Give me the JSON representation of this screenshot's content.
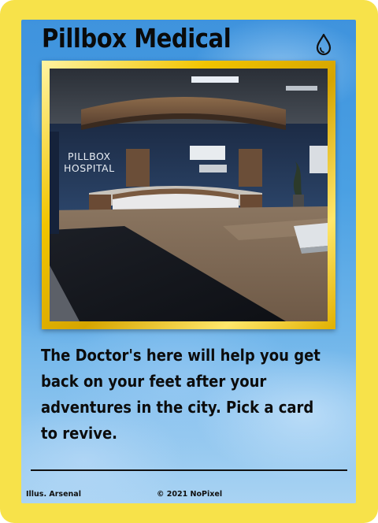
{
  "card": {
    "title": "Pillbox Medical",
    "element_icon": "water-drop-icon",
    "art": {
      "sign_line1": "PILLBOX",
      "sign_line2": "HOSPITAL"
    },
    "description": "The Doctor's here will help you get back on your feet after your adventures in the city. Pick a card to revive.",
    "illustrator": "Illus. Arsenal",
    "copyright": "© 2021 NoPixel"
  },
  "colors": {
    "border": "#f7e24a",
    "background": "#4aa0e3",
    "frame_gold": "#f1c400",
    "text": "#0c0c0c"
  }
}
